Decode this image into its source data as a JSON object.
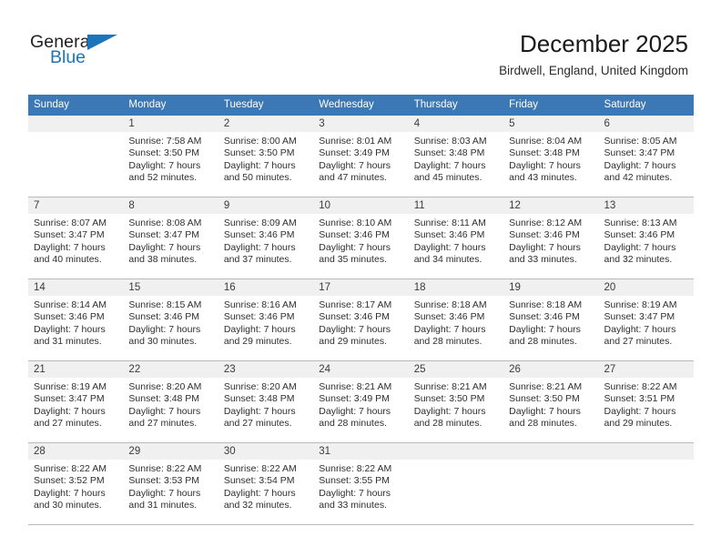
{
  "brand": {
    "name_top": "General",
    "name_bottom": "Blue",
    "accent_color": "#1b75bb"
  },
  "header": {
    "title": "December 2025",
    "subtitle": "Birdwell, England, United Kingdom"
  },
  "calendar": {
    "header_bg": "#3b78b5",
    "daynum_bg": "#f0f0f0",
    "weekdays": [
      "Sunday",
      "Monday",
      "Tuesday",
      "Wednesday",
      "Thursday",
      "Friday",
      "Saturday"
    ],
    "weeks": [
      [
        {
          "day": "",
          "lines": []
        },
        {
          "day": "1",
          "lines": [
            "Sunrise: 7:58 AM",
            "Sunset: 3:50 PM",
            "Daylight: 7 hours",
            "and 52 minutes."
          ]
        },
        {
          "day": "2",
          "lines": [
            "Sunrise: 8:00 AM",
            "Sunset: 3:50 PM",
            "Daylight: 7 hours",
            "and 50 minutes."
          ]
        },
        {
          "day": "3",
          "lines": [
            "Sunrise: 8:01 AM",
            "Sunset: 3:49 PM",
            "Daylight: 7 hours",
            "and 47 minutes."
          ]
        },
        {
          "day": "4",
          "lines": [
            "Sunrise: 8:03 AM",
            "Sunset: 3:48 PM",
            "Daylight: 7 hours",
            "and 45 minutes."
          ]
        },
        {
          "day": "5",
          "lines": [
            "Sunrise: 8:04 AM",
            "Sunset: 3:48 PM",
            "Daylight: 7 hours",
            "and 43 minutes."
          ]
        },
        {
          "day": "6",
          "lines": [
            "Sunrise: 8:05 AM",
            "Sunset: 3:47 PM",
            "Daylight: 7 hours",
            "and 42 minutes."
          ]
        }
      ],
      [
        {
          "day": "7",
          "lines": [
            "Sunrise: 8:07 AM",
            "Sunset: 3:47 PM",
            "Daylight: 7 hours",
            "and 40 minutes."
          ]
        },
        {
          "day": "8",
          "lines": [
            "Sunrise: 8:08 AM",
            "Sunset: 3:47 PM",
            "Daylight: 7 hours",
            "and 38 minutes."
          ]
        },
        {
          "day": "9",
          "lines": [
            "Sunrise: 8:09 AM",
            "Sunset: 3:46 PM",
            "Daylight: 7 hours",
            "and 37 minutes."
          ]
        },
        {
          "day": "10",
          "lines": [
            "Sunrise: 8:10 AM",
            "Sunset: 3:46 PM",
            "Daylight: 7 hours",
            "and 35 minutes."
          ]
        },
        {
          "day": "11",
          "lines": [
            "Sunrise: 8:11 AM",
            "Sunset: 3:46 PM",
            "Daylight: 7 hours",
            "and 34 minutes."
          ]
        },
        {
          "day": "12",
          "lines": [
            "Sunrise: 8:12 AM",
            "Sunset: 3:46 PM",
            "Daylight: 7 hours",
            "and 33 minutes."
          ]
        },
        {
          "day": "13",
          "lines": [
            "Sunrise: 8:13 AM",
            "Sunset: 3:46 PM",
            "Daylight: 7 hours",
            "and 32 minutes."
          ]
        }
      ],
      [
        {
          "day": "14",
          "lines": [
            "Sunrise: 8:14 AM",
            "Sunset: 3:46 PM",
            "Daylight: 7 hours",
            "and 31 minutes."
          ]
        },
        {
          "day": "15",
          "lines": [
            "Sunrise: 8:15 AM",
            "Sunset: 3:46 PM",
            "Daylight: 7 hours",
            "and 30 minutes."
          ]
        },
        {
          "day": "16",
          "lines": [
            "Sunrise: 8:16 AM",
            "Sunset: 3:46 PM",
            "Daylight: 7 hours",
            "and 29 minutes."
          ]
        },
        {
          "day": "17",
          "lines": [
            "Sunrise: 8:17 AM",
            "Sunset: 3:46 PM",
            "Daylight: 7 hours",
            "and 29 minutes."
          ]
        },
        {
          "day": "18",
          "lines": [
            "Sunrise: 8:18 AM",
            "Sunset: 3:46 PM",
            "Daylight: 7 hours",
            "and 28 minutes."
          ]
        },
        {
          "day": "19",
          "lines": [
            "Sunrise: 8:18 AM",
            "Sunset: 3:46 PM",
            "Daylight: 7 hours",
            "and 28 minutes."
          ]
        },
        {
          "day": "20",
          "lines": [
            "Sunrise: 8:19 AM",
            "Sunset: 3:47 PM",
            "Daylight: 7 hours",
            "and 27 minutes."
          ]
        }
      ],
      [
        {
          "day": "21",
          "lines": [
            "Sunrise: 8:19 AM",
            "Sunset: 3:47 PM",
            "Daylight: 7 hours",
            "and 27 minutes."
          ]
        },
        {
          "day": "22",
          "lines": [
            "Sunrise: 8:20 AM",
            "Sunset: 3:48 PM",
            "Daylight: 7 hours",
            "and 27 minutes."
          ]
        },
        {
          "day": "23",
          "lines": [
            "Sunrise: 8:20 AM",
            "Sunset: 3:48 PM",
            "Daylight: 7 hours",
            "and 27 minutes."
          ]
        },
        {
          "day": "24",
          "lines": [
            "Sunrise: 8:21 AM",
            "Sunset: 3:49 PM",
            "Daylight: 7 hours",
            "and 28 minutes."
          ]
        },
        {
          "day": "25",
          "lines": [
            "Sunrise: 8:21 AM",
            "Sunset: 3:50 PM",
            "Daylight: 7 hours",
            "and 28 minutes."
          ]
        },
        {
          "day": "26",
          "lines": [
            "Sunrise: 8:21 AM",
            "Sunset: 3:50 PM",
            "Daylight: 7 hours",
            "and 28 minutes."
          ]
        },
        {
          "day": "27",
          "lines": [
            "Sunrise: 8:22 AM",
            "Sunset: 3:51 PM",
            "Daylight: 7 hours",
            "and 29 minutes."
          ]
        }
      ],
      [
        {
          "day": "28",
          "lines": [
            "Sunrise: 8:22 AM",
            "Sunset: 3:52 PM",
            "Daylight: 7 hours",
            "and 30 minutes."
          ]
        },
        {
          "day": "29",
          "lines": [
            "Sunrise: 8:22 AM",
            "Sunset: 3:53 PM",
            "Daylight: 7 hours",
            "and 31 minutes."
          ]
        },
        {
          "day": "30",
          "lines": [
            "Sunrise: 8:22 AM",
            "Sunset: 3:54 PM",
            "Daylight: 7 hours",
            "and 32 minutes."
          ]
        },
        {
          "day": "31",
          "lines": [
            "Sunrise: 8:22 AM",
            "Sunset: 3:55 PM",
            "Daylight: 7 hours",
            "and 33 minutes."
          ]
        },
        {
          "day": "",
          "lines": []
        },
        {
          "day": "",
          "lines": []
        },
        {
          "day": "",
          "lines": []
        }
      ]
    ]
  }
}
